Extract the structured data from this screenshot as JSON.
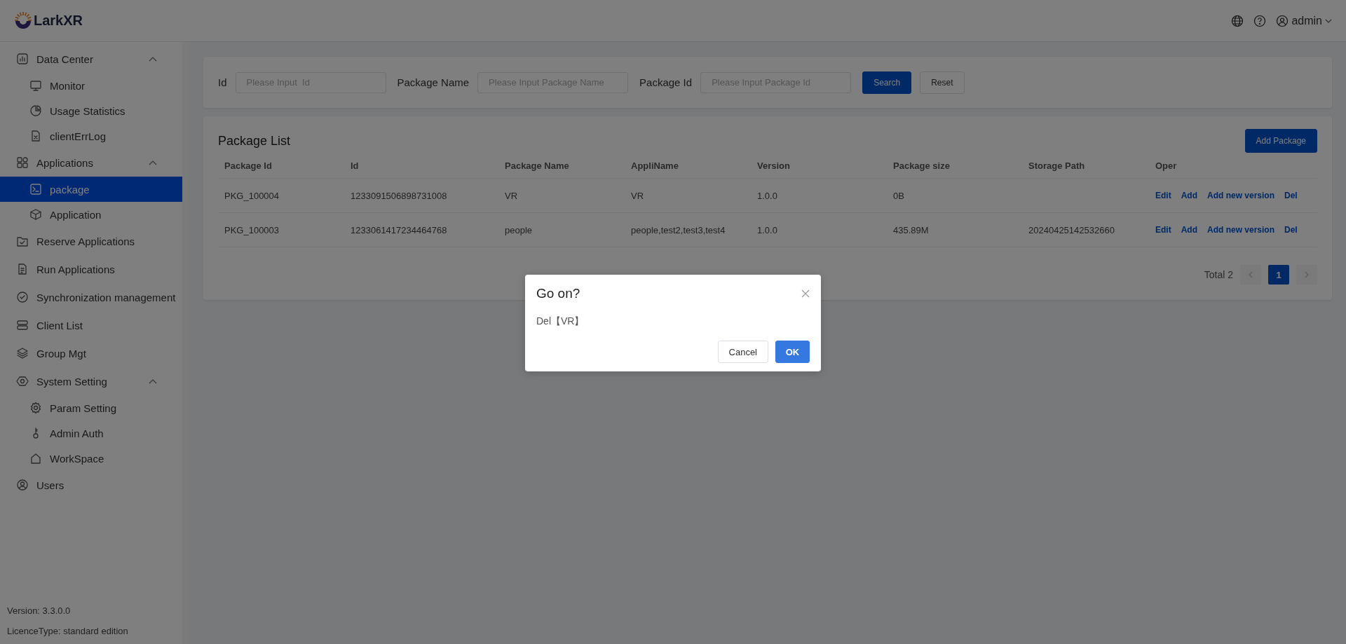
{
  "header": {
    "logo": "LarkXR",
    "user": "admin"
  },
  "sidebar": {
    "items": [
      {
        "label": "Data Center",
        "expanded": true,
        "selected": false,
        "children": [
          {
            "label": "Monitor",
            "selected": false
          },
          {
            "label": "Usage Statistics",
            "selected": false
          },
          {
            "label": "clientErrLog",
            "selected": false
          }
        ]
      },
      {
        "label": "Applications",
        "expanded": true,
        "selected": false,
        "children": [
          {
            "label": "package",
            "selected": true
          },
          {
            "label": "Application",
            "selected": false
          }
        ]
      },
      {
        "label": "Reserve Applications",
        "selected": false
      },
      {
        "label": "Run Applications",
        "selected": false
      },
      {
        "label": "Synchronization management",
        "selected": false
      },
      {
        "label": "Client List",
        "selected": false
      },
      {
        "label": "Group Mgt",
        "selected": false
      },
      {
        "label": "System Setting",
        "expanded": true,
        "selected": false,
        "children": [
          {
            "label": "Param Setting",
            "selected": false
          },
          {
            "label": "Admin Auth",
            "selected": false
          },
          {
            "label": "WorkSpace",
            "selected": false
          }
        ]
      },
      {
        "label": "Users",
        "selected": false
      }
    ],
    "version": "Version: 3.3.0.0",
    "licence": "LicenceType: standard edition"
  },
  "filters": {
    "fields": [
      {
        "label": "Id",
        "placeholder": "Please Input  Id"
      },
      {
        "label": "Package Name",
        "placeholder": "Please Input Package Name"
      },
      {
        "label": "Package Id",
        "placeholder": "Please Input Package Id"
      }
    ],
    "search": "Search",
    "reset": "Reset"
  },
  "package_list": {
    "title": "Package List",
    "add_button": "Add Package",
    "columns": [
      "Package Id",
      "Id",
      "Package Name",
      "AppliName",
      "Version",
      "Package size",
      "Storage Path",
      "Oper"
    ],
    "rows": [
      {
        "cells": [
          "PKG_100004",
          "1233091506898731008",
          "VR",
          "VR",
          "1.0.0",
          "0B",
          ""
        ],
        "actions": [
          "Edit",
          "Add",
          "Add new version",
          "Del"
        ]
      },
      {
        "cells": [
          "PKG_100003",
          "1233061417234464768",
          "people",
          "people,test2,test3,test4",
          "1.0.0",
          "435.89M",
          "20240425142532660"
        ],
        "actions": [
          "Edit",
          "Add",
          "Add new version",
          "Del"
        ]
      }
    ],
    "pagination": {
      "total": "Total 2",
      "prev_disabled": true,
      "next_disabled": true,
      "pages": [
        {
          "label": "1",
          "selected": true
        }
      ]
    }
  },
  "dialog": {
    "title": "Go on?",
    "message": "Del【VR】",
    "cancel": "Cancel",
    "ok": "OK"
  }
}
